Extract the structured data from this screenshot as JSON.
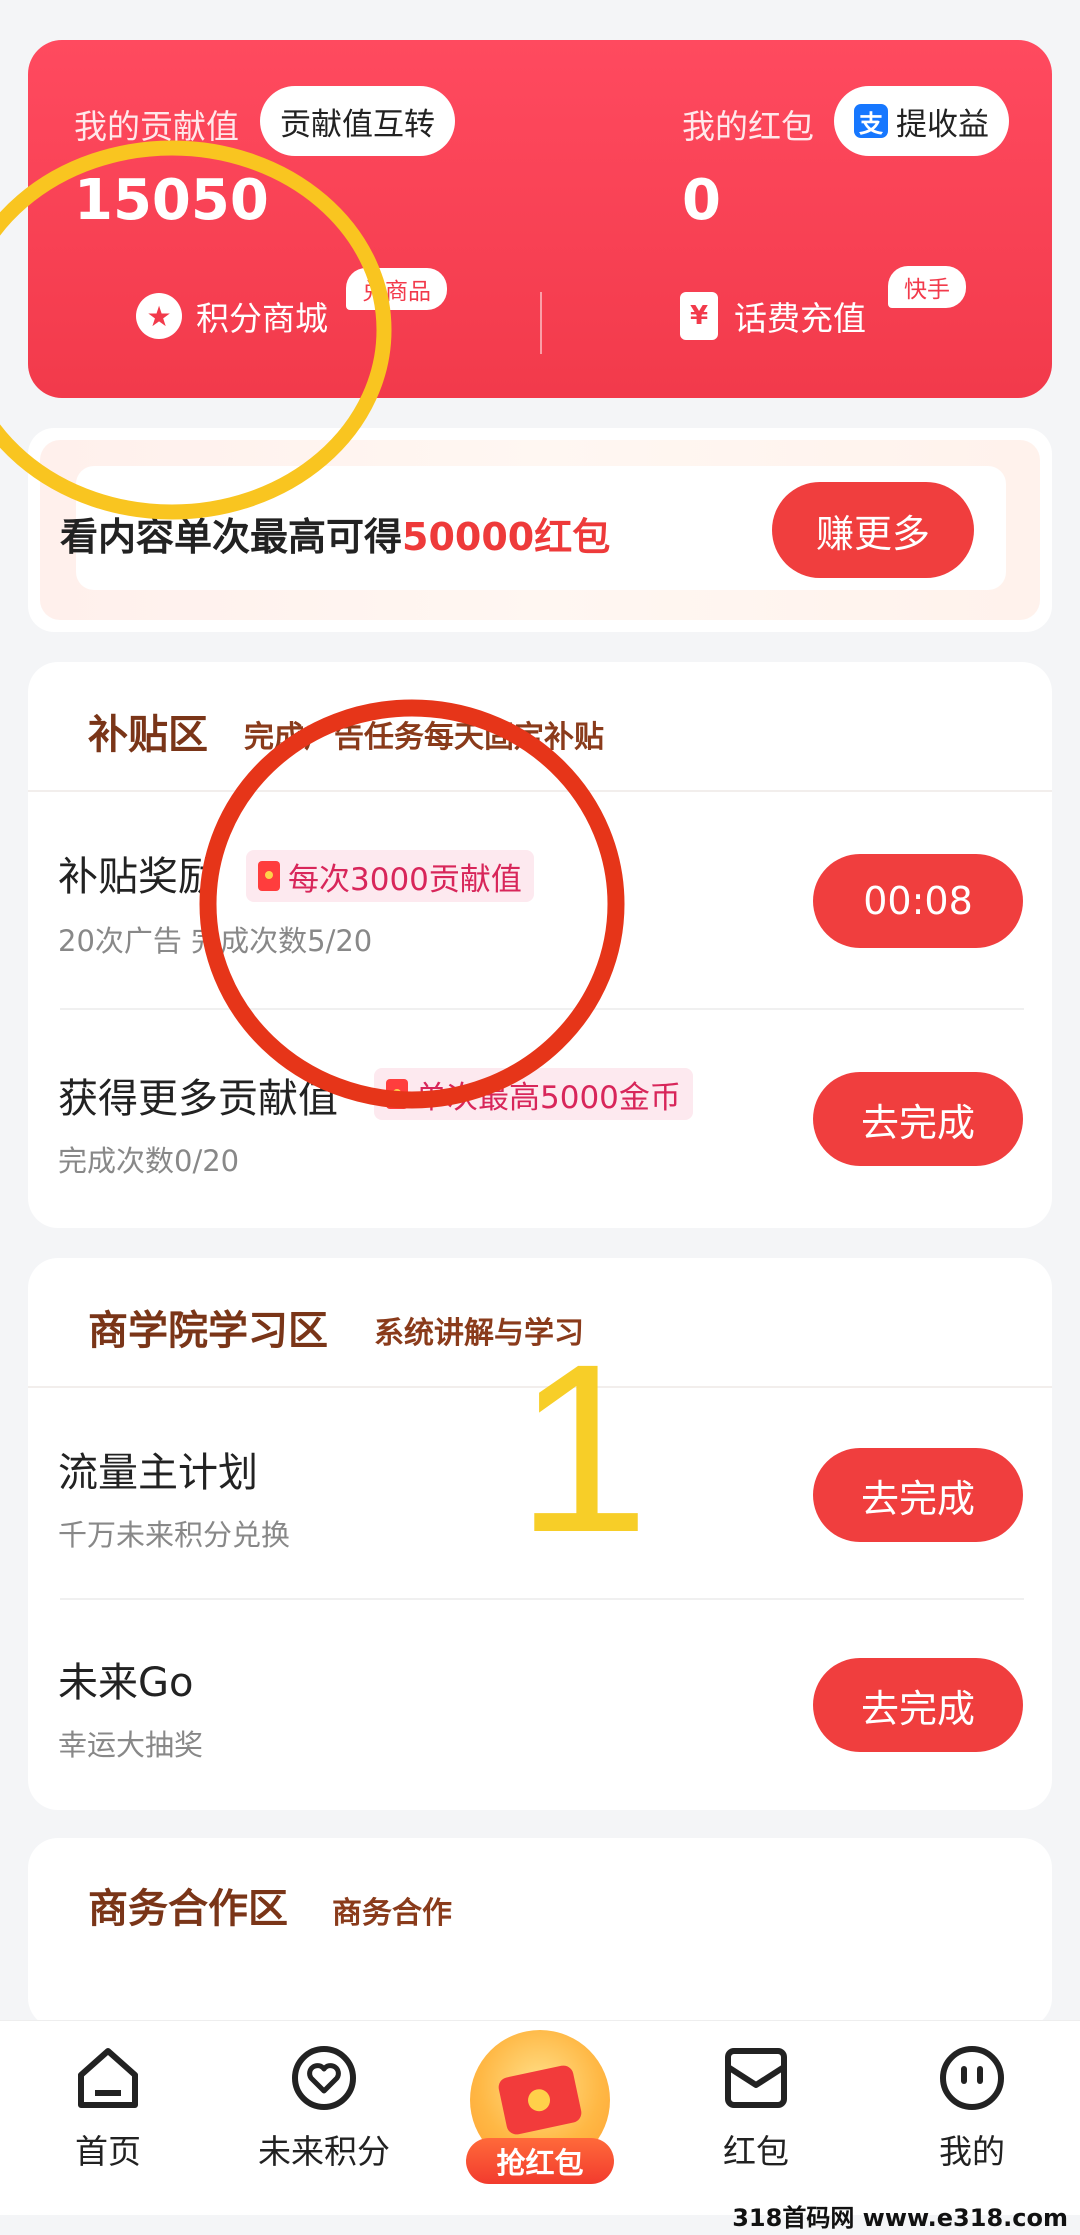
{
  "top_card": {
    "contribution_label": "我的贡献值",
    "contribution_swap": "贡献值互转",
    "contribution_value": "15050",
    "redpacket_label": "我的红包",
    "withdraw_label": "提收益",
    "redpacket_value": "0",
    "points_mall": "积分商城",
    "points_badge": "兑商品",
    "phone_recharge": "话费充值",
    "phone_badge": "快手"
  },
  "banner": {
    "text_prefix": "看内容单次最高可得",
    "text_highlight": "50000红包",
    "button": "赚更多"
  },
  "subsidy": {
    "title": "补贴区",
    "subtitle": "完成广告任务每天固定补贴",
    "tasks": [
      {
        "title": "补贴奖励",
        "tag": "每次3000贡献值",
        "sub": "20次广告  完成次数5/20",
        "button": "00:08"
      },
      {
        "title": "获得更多贡献值",
        "tag": "单次最高5000金币",
        "sub": "完成次数0/20",
        "button": "去完成"
      }
    ]
  },
  "academy": {
    "title": "商学院学习区",
    "subtitle": "系统讲解与学习",
    "tasks": [
      {
        "title": "流量主计划",
        "sub": "千万未来积分兑换",
        "button": "去完成"
      },
      {
        "title": "未来Go",
        "sub": "幸运大抽奖",
        "button": "去完成"
      }
    ]
  },
  "business": {
    "title": "商务合作区",
    "subtitle": "商务合作"
  },
  "nav": {
    "home": "首页",
    "points": "未来积分",
    "grab": "抢红包",
    "redpacket": "红包",
    "mine": "我的"
  },
  "annotation_number": "1",
  "watermark": "318首码网 www.e318.com",
  "colors": {
    "primary_red": "#f23a4b",
    "button_red": "#f03e3e",
    "section_title": "#7a3518"
  }
}
